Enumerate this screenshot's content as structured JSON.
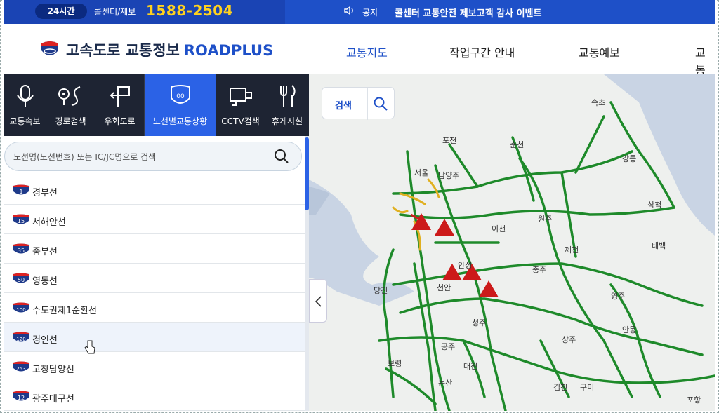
{
  "topbar": {
    "badge": "24시간",
    "callcenter": "콜센터/제보",
    "phone": "1588-2504",
    "notice_label": "공지",
    "notice_text": "콜센터 교통안전 제보고객 감사 이벤트"
  },
  "header": {
    "logo_text": "고속도로 교통정보",
    "logo_brand": "ROADPLUS",
    "nav": [
      "교통지도",
      "작업구간 안내",
      "교통예보",
      "교통"
    ]
  },
  "tabs": [
    {
      "label": "교통속보",
      "icon": "mic-icon"
    },
    {
      "label": "경로검색",
      "icon": "route-icon"
    },
    {
      "label": "우회도로",
      "icon": "detour-icon"
    },
    {
      "label": "노선별교통상황",
      "icon": "route-shield-icon"
    },
    {
      "label": "CCTV검색",
      "icon": "cctv-icon"
    },
    {
      "label": "휴게시설",
      "icon": "restaurant-icon"
    }
  ],
  "search": {
    "placeholder": "노선명(노선번호) 또는 IC/JC명으로 검색"
  },
  "routes": [
    {
      "num": "1",
      "name": "경부선"
    },
    {
      "num": "15",
      "name": "서해안선"
    },
    {
      "num": "35",
      "name": "중부선"
    },
    {
      "num": "50",
      "name": "영동선"
    },
    {
      "num": "100",
      "name": "수도권제1순환선"
    },
    {
      "num": "120",
      "name": "경인선"
    },
    {
      "num": "253",
      "name": "고창담양선"
    },
    {
      "num": "12",
      "name": "광주대구선"
    }
  ],
  "map": {
    "search_label": "검색",
    "cities": [
      "속초",
      "포천",
      "춘천",
      "강릉",
      "서울",
      "남양주",
      "원주",
      "삼척",
      "이천",
      "태백",
      "제천",
      "안성",
      "충주",
      "당진",
      "천안",
      "영주",
      "청주",
      "안동",
      "상주",
      "공주",
      "보령",
      "대전",
      "논산",
      "김천",
      "구미",
      "포항"
    ],
    "colors": {
      "road_green": "#1e8a2a",
      "road_yellow": "#e0b020",
      "incident_red": "#cc1a1a",
      "sea": "#c9d4e4"
    }
  }
}
